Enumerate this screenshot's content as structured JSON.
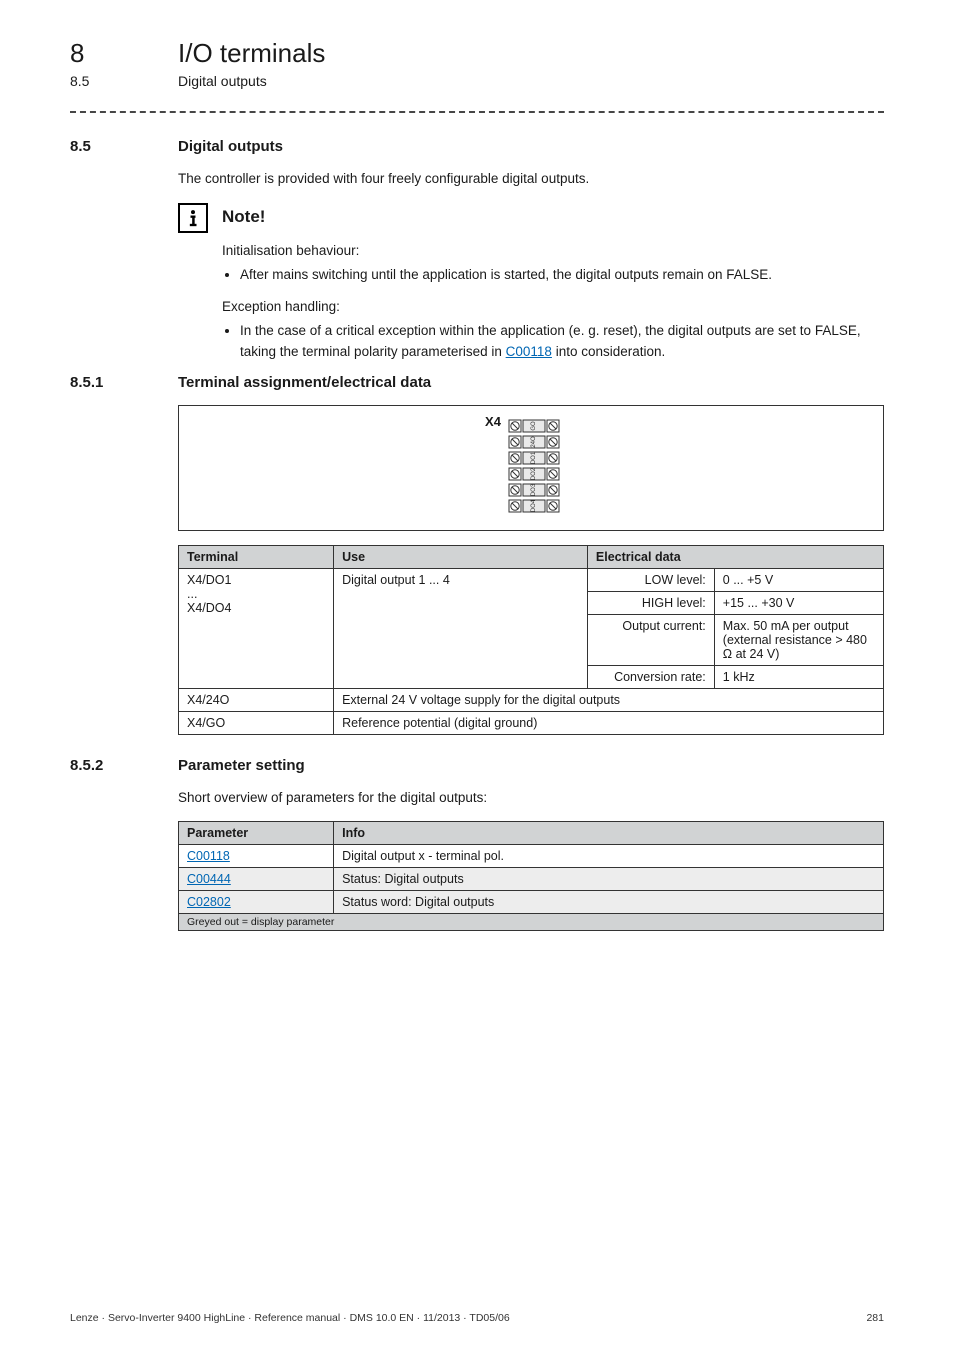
{
  "header": {
    "chapter_number": "8",
    "chapter_title": "I/O terminals",
    "section_number": "8.5",
    "section_title": "Digital outputs"
  },
  "s85": {
    "num": "8.5",
    "title": "Digital outputs",
    "intro": "The controller is provided with four freely configurable digital outputs."
  },
  "note": {
    "title": "Note!",
    "init_label": "Initialisation behaviour:",
    "init_bullet": "After mains switching until the application is started, the digital outputs remain on FALSE.",
    "exc_label": "Exception handling:",
    "exc_bullet_a": "In the case of a critical exception within the application (e. g. reset), the digital outputs are set to FALSE, taking the terminal polarity parameterised in ",
    "exc_link": "C00118",
    "exc_bullet_b": " into consideration."
  },
  "s851": {
    "num": "8.5.1",
    "title": "Terminal assignment/electrical data"
  },
  "terminal_block": {
    "label": "X4",
    "pins": [
      "GO",
      "24O",
      "DO1",
      "DO2",
      "DO3",
      "DO4"
    ]
  },
  "spec_table": {
    "headers": {
      "terminal": "Terminal",
      "use": "Use",
      "edata": "Electrical data"
    },
    "do_term": "X4/DO1\n...\nX4/DO4",
    "do_use": "Digital output 1 ... 4",
    "rows": {
      "low": {
        "k": "LOW level:",
        "v": "0 ... +5 V"
      },
      "high": {
        "k": "HIGH level:",
        "v": "+15 ... +30 V"
      },
      "out": {
        "k": "Output current:",
        "v": "Max. 50 mA per output (external resistance > 480 Ω at 24 V)"
      },
      "conv": {
        "k": "Conversion rate:",
        "v": "1 kHz"
      }
    },
    "r24o": {
      "t": "X4/24O",
      "u": "External 24 V voltage supply for the digital outputs"
    },
    "rgo": {
      "t": "X4/GO",
      "u": "Reference potential (digital ground)"
    }
  },
  "s852": {
    "num": "8.5.2",
    "title": "Parameter setting",
    "intro": "Short overview of parameters for the digital outputs:"
  },
  "param_table": {
    "headers": {
      "param": "Parameter",
      "info": "Info"
    },
    "rows": [
      {
        "p": "C00118",
        "i": "Digital output x - terminal pol.",
        "shaded": false
      },
      {
        "p": "C00444",
        "i": "Status: Digital outputs",
        "shaded": true
      },
      {
        "p": "C02802",
        "i": "Status word: Digital outputs",
        "shaded": true
      }
    ],
    "footnote": "Greyed out = display parameter"
  },
  "footer": {
    "left": "Lenze · Servo-Inverter 9400 HighLine · Reference manual · DMS 10.0 EN · 11/2013 · TD05/06",
    "right": "281"
  }
}
